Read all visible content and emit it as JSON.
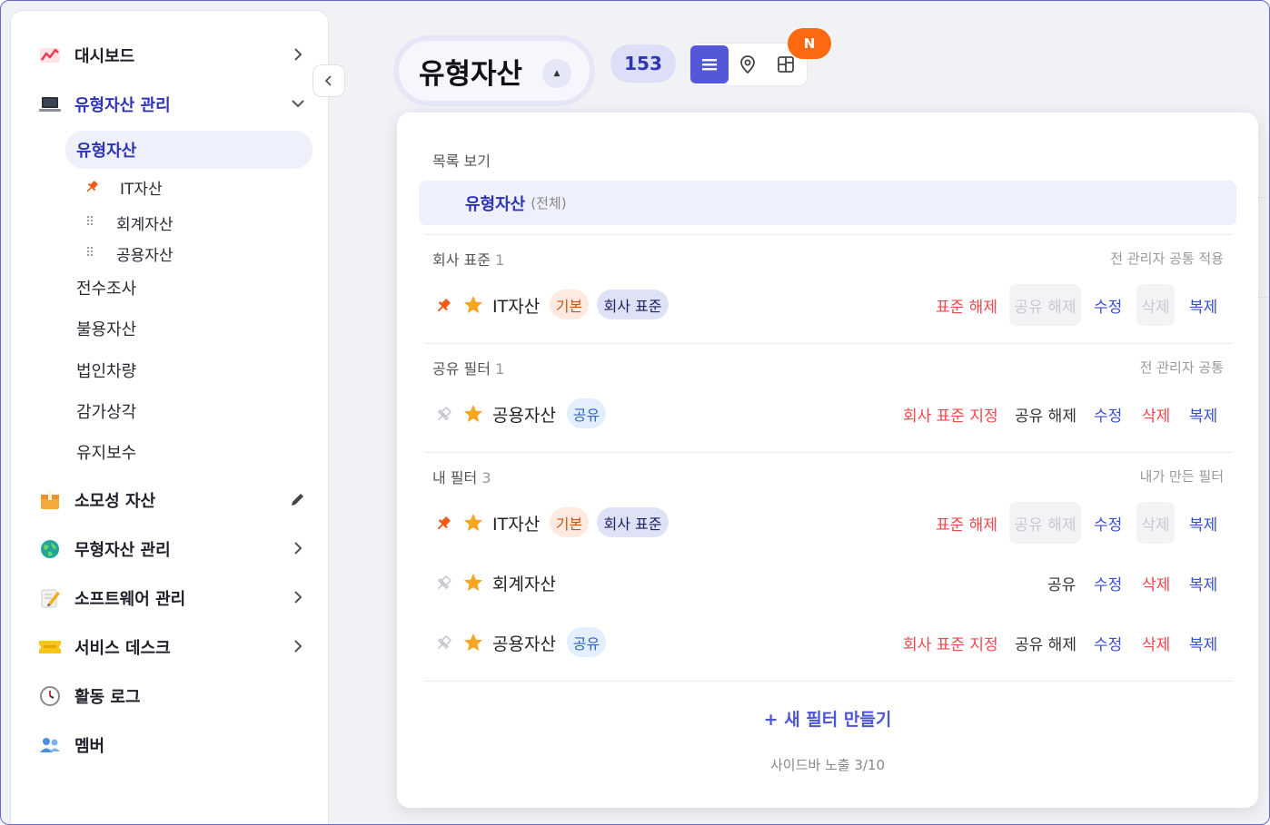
{
  "sidebar": {
    "items": [
      {
        "label": "대시보드",
        "icon": "chart-icon"
      },
      {
        "label": "유형자산 관리",
        "icon": "laptop-icon"
      },
      {
        "label": "소모성 자산",
        "icon": "box-icon"
      },
      {
        "label": "무형자산 관리",
        "icon": "globe-icon"
      },
      {
        "label": "소프트웨어 관리",
        "icon": "memo-icon"
      },
      {
        "label": "서비스 데스크",
        "icon": "ticket-icon"
      },
      {
        "label": "활동 로그",
        "icon": "clock-icon"
      },
      {
        "label": "멤버",
        "icon": "people-icon"
      }
    ],
    "sub_active": "유형자산",
    "subsub": [
      "IT자산",
      "회계자산",
      "공용자산"
    ],
    "sub": [
      "전수조사",
      "불용자산",
      "법인차량",
      "감가상각",
      "유지보수"
    ]
  },
  "header": {
    "title": "유형자산",
    "count": "153",
    "new_badge": "N"
  },
  "panel": {
    "list_view_title": "목록 보기",
    "all_row": {
      "name": "유형자산",
      "suffix": "(전체)"
    },
    "sections": [
      {
        "title": "회사 표준",
        "count": "1",
        "right": "전 관리자 공통 적용"
      },
      {
        "title": "공유 필터",
        "count": "1",
        "right": "전 관리자 공통"
      },
      {
        "title": "내 필터",
        "count": "3",
        "right": "내가 만든 필터"
      }
    ],
    "rows": [
      {
        "name": "IT자산",
        "tag1": "기본",
        "tag2": "회사 표준",
        "a1": "표준 해제",
        "a2": "공유 해제",
        "a3": "수정",
        "a4": "삭제",
        "a5": "복제"
      },
      {
        "name": "공용자산",
        "tag1": "공유",
        "a1": "회사 표준 지정",
        "a2": "공유 해제",
        "a3": "수정",
        "a4": "삭제",
        "a5": "복제"
      },
      {
        "name": "IT자산",
        "tag1": "기본",
        "tag2": "회사 표준",
        "a1": "표준 해제",
        "a2": "공유 해제",
        "a3": "수정",
        "a4": "삭제",
        "a5": "복제"
      },
      {
        "name": "회계자산",
        "a2": "공유",
        "a3": "수정",
        "a4": "삭제",
        "a5": "복제"
      },
      {
        "name": "공용자산",
        "tag1": "공유",
        "a1": "회사 표준 지정",
        "a2": "공유 해제",
        "a3": "수정",
        "a4": "삭제",
        "a5": "복제"
      }
    ],
    "new_filter": "+ 새 필터 만들기",
    "footer": "사이드바 노출 3/10"
  },
  "colors": {
    "accent": "#5558d6",
    "danger": "#f0474d",
    "badge": "#fb6a10"
  }
}
